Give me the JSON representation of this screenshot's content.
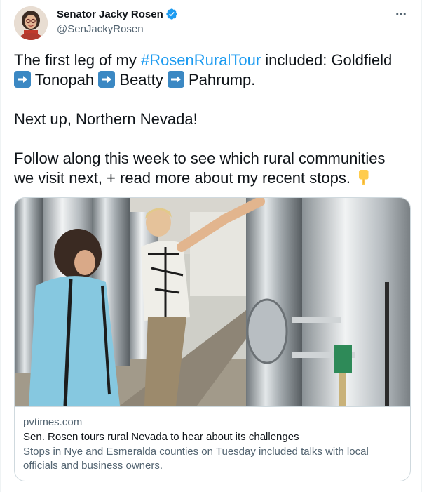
{
  "author": {
    "name": "Senator Jacky Rosen",
    "handle": "@SenJackyRosen",
    "verified": true,
    "avatar_icon": "profile-photo"
  },
  "menu_icon": "more-horizontal-icon",
  "tweet": {
    "line1_prefix": "The first leg of my ",
    "hashtag": "#RosenRuralTour",
    "line1_suffix": " included: Goldfield",
    "stop1": "Tonopah",
    "stop2": "Beatty",
    "stop3": "Pahrump.",
    "para2": "Next up, Northern Nevada!",
    "para3_line1": "Follow along this week to see which rural communities",
    "para3_line2": "we visit next, + read more about my recent stops.",
    "pointing_emoji": "pointing-down-hand-icon"
  },
  "card": {
    "image_desc": "photo-brewery-tanks",
    "domain": "pvtimes.com",
    "title": "Sen. Rosen tours rural Nevada to hear about its challenges",
    "description_line1": "Stops in Nye and Esmeralda counties on Tuesday included talks with local",
    "description_line2": "officials and business owners."
  },
  "colors": {
    "link": "#1d9bf0",
    "secondary_text": "#536471",
    "border": "#cfd9de",
    "arrow_emoji": "#3b88c3"
  }
}
